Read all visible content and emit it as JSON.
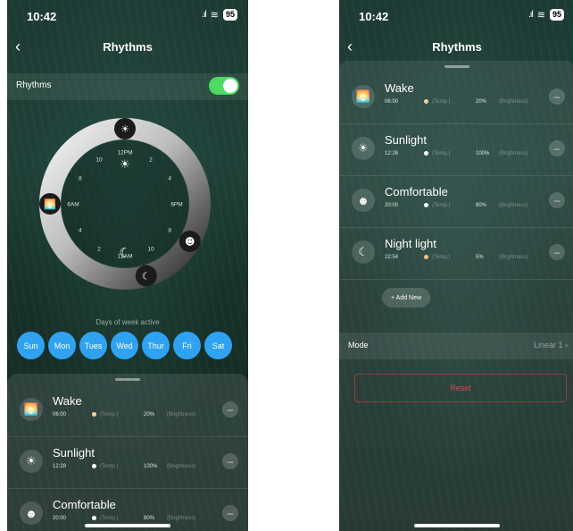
{
  "status": {
    "time": "10:42",
    "battery": "95",
    "signal": ".ıl",
    "wifi": "≋"
  },
  "nav": {
    "title": "Rhythms",
    "back": "‹"
  },
  "toggle": {
    "label": "Rhythms",
    "on": true
  },
  "dial": {
    "hour_labels": [
      "12PM",
      "2",
      "4",
      "6PM",
      "8",
      "10",
      "12AM",
      "2",
      "4",
      "6AM",
      "8",
      "10"
    ],
    "markers": [
      {
        "icon": "sun-icon",
        "glyph": "☀",
        "hour": 12
      },
      {
        "icon": "sunrise-icon",
        "glyph": "🌅",
        "hour": 6
      },
      {
        "icon": "smiley-icon",
        "glyph": "☻",
        "hour": 20
      },
      {
        "icon": "moon-icon",
        "glyph": "☾",
        "hour": 22.9
      }
    ],
    "inner_sun": "☀",
    "inner_moon": "☾"
  },
  "days": {
    "label": "Days of week active",
    "items": [
      "Sun",
      "Mon",
      "Tues",
      "Wed",
      "Thur",
      "Fri",
      "Sat"
    ]
  },
  "entries": [
    {
      "name": "Wake",
      "time": "06:00",
      "temp_label": "(Temp.)",
      "brightness": "20%",
      "brightness_label": "(Brightness)",
      "icon": "sunrise-icon",
      "glyph": "🌅",
      "dot_color": "#f6d59a"
    },
    {
      "name": "Sunlight",
      "time": "12:28",
      "temp_label": "(Temp.)",
      "brightness": "100%",
      "brightness_label": "(Brightness)",
      "icon": "sun-icon",
      "glyph": "☀",
      "dot_color": "#ffffff"
    },
    {
      "name": "Comfortable",
      "time": "20:00",
      "temp_label": "(Temp.)",
      "brightness": "80%",
      "brightness_label": "(Brightness)",
      "icon": "smiley-icon",
      "glyph": "☻",
      "dot_color": "#ffffff"
    },
    {
      "name": "Night light",
      "time": "22:54",
      "temp_label": "(Temp.)",
      "brightness": "5%",
      "brightness_label": "(Brightness)",
      "icon": "moon-icon",
      "glyph": "☾",
      "dot_color": "#f6c27a"
    }
  ],
  "add_new": "+ Add New",
  "mode": {
    "label": "Mode",
    "value": "Linear 1 ›"
  },
  "reset": "Reset",
  "minus_glyph": "–",
  "colors": {
    "accent_blue": "#2fa3f2",
    "toggle_green": "#4cd964",
    "reset_red": "#e04646"
  }
}
